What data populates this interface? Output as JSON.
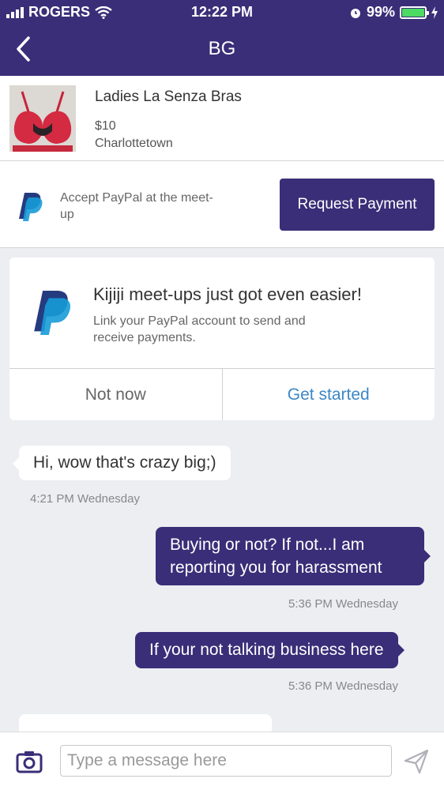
{
  "status_bar": {
    "carrier": "ROGERS",
    "time": "12:22 PM",
    "battery": "99%",
    "battery_level": 0.99
  },
  "header": {
    "title": "BG",
    "back_icon": "chevron-left-icon"
  },
  "listing": {
    "name": "Ladies La Senza Bras",
    "price": "$10",
    "location": "Charlottetown"
  },
  "payment": {
    "text": "Accept PayPal at the meet-up",
    "button_label": "Request Payment",
    "icon": "paypal-icon"
  },
  "promo": {
    "headline": "Kijiji meet-ups just got even easier!",
    "subtext": "Link your PayPal account to send and receive payments.",
    "not_now": "Not now",
    "get_started": "Get started",
    "icon": "paypal-icon"
  },
  "messages": [
    {
      "direction": "incoming",
      "text": "Hi, wow that's crazy big;)",
      "timestamp": "4:21 PM Wednesday"
    },
    {
      "direction": "outgoing",
      "text": "Buying or not? If not...I am reporting you for harassment",
      "line1": "Buying or not? If not...I am",
      "line2": "reporting you for harassment",
      "timestamp": "5:36 PM Wednesday"
    },
    {
      "direction": "outgoing",
      "text": "If your not talking business here",
      "timestamp": "5:36 PM Wednesday"
    }
  ],
  "composer": {
    "placeholder": "Type a message here",
    "camera_icon": "camera-icon",
    "send_icon": "send-icon"
  },
  "colors": {
    "brand": "#3a2e78",
    "link": "#3d86c6",
    "background": "#eceef2"
  }
}
